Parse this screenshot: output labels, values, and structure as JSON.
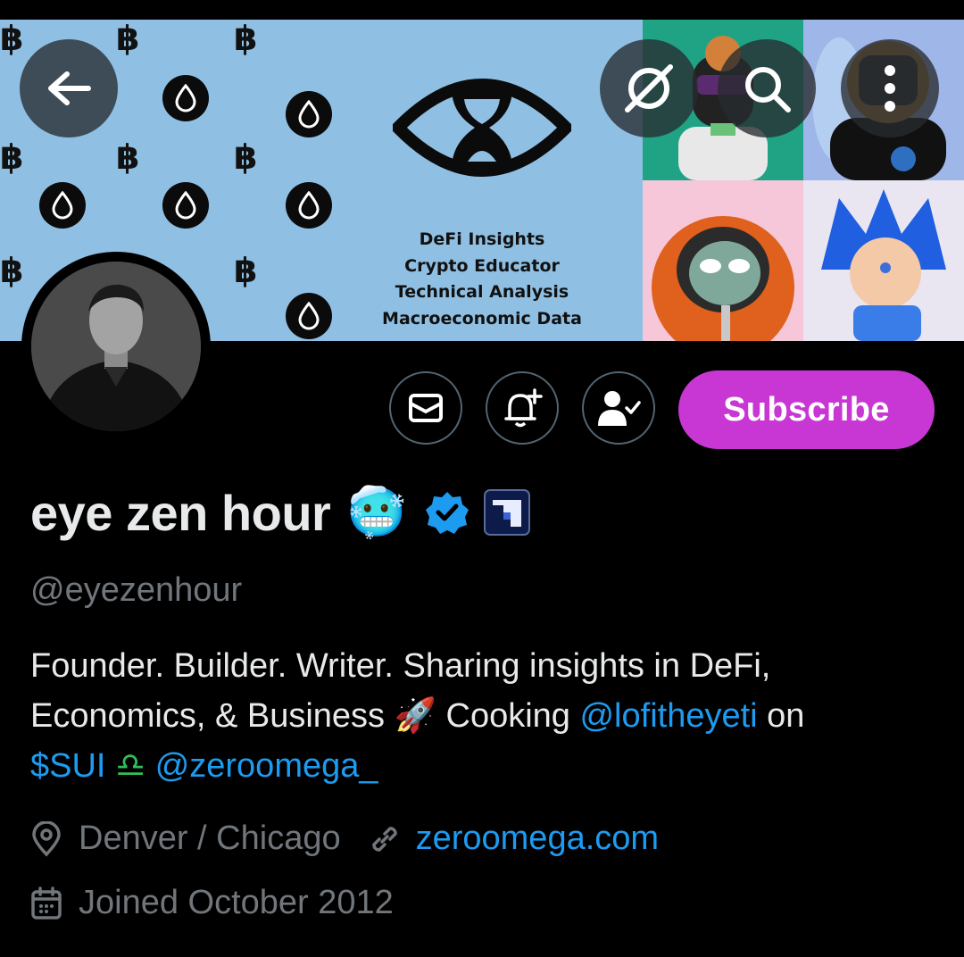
{
  "banner": {
    "lines": [
      "DeFi Insights",
      "Crypto Educator",
      "Technical Analysis",
      "Macroeconomic Data"
    ],
    "btc_glyph": "฿"
  },
  "nav": {
    "back_icon": "arrow-left-icon",
    "grok_icon": "grok-icon",
    "search_icon": "search-icon",
    "more_icon": "more-vertical-icon"
  },
  "actions": {
    "message_icon": "envelope-icon",
    "notify_icon": "bell-plus-icon",
    "following_icon": "person-check-icon",
    "subscribe_label": "Subscribe"
  },
  "profile": {
    "display_name": "eye zen hour",
    "emoji": "🥶",
    "handle": "@eyezenhour",
    "bio_1": "Founder. Builder. Writer. Sharing insights in DeFi,",
    "bio_2a": "Economics, & Business ",
    "bio_rocket": "🚀",
    "bio_2b": " Cooking ",
    "bio_mention_1": "@lofitheyeti",
    "bio_2c": " on",
    "bio_cashtag": "$SUI",
    "bio_libra": "♎",
    "bio_mention_2": "@zeroomega_",
    "location": "Denver / Chicago",
    "website": "zeroomega.com",
    "joined": "Joined October 2012"
  },
  "colors": {
    "accent": "#1d9bf0",
    "subscribe": "#c837d3",
    "muted": "#71767b",
    "verified": "#1d9bf0"
  }
}
